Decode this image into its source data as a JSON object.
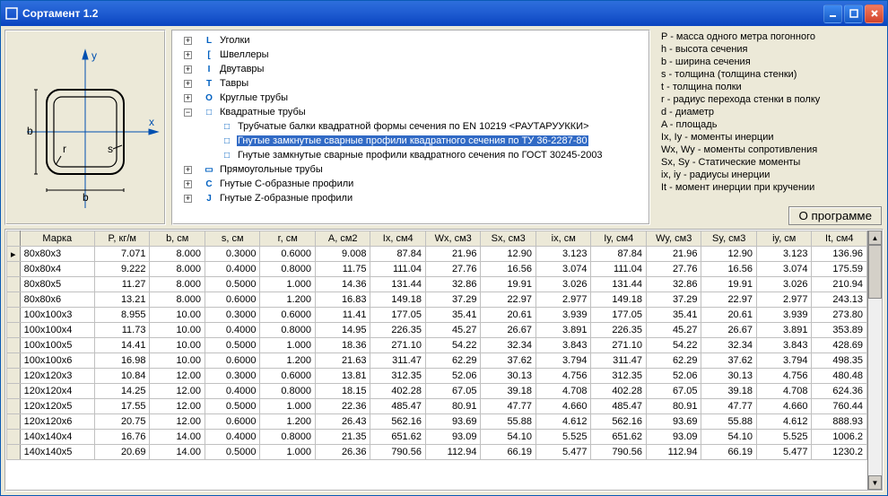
{
  "window": {
    "title": "Сортамент 1.2"
  },
  "tree": [
    {
      "depth": 0,
      "pm": "+",
      "icon": "L",
      "iconColor": "#0060C0",
      "label": "Уголки"
    },
    {
      "depth": 0,
      "pm": "+",
      "icon": "[",
      "iconColor": "#0060C0",
      "label": "Швеллеры"
    },
    {
      "depth": 0,
      "pm": "+",
      "icon": "I",
      "iconColor": "#0060C0",
      "label": "Двутавры"
    },
    {
      "depth": 0,
      "pm": "+",
      "icon": "T",
      "iconColor": "#0060C0",
      "label": "Тавры"
    },
    {
      "depth": 0,
      "pm": "+",
      "icon": "O",
      "iconColor": "#0060C0",
      "label": "Круглые трубы"
    },
    {
      "depth": 0,
      "pm": "−",
      "icon": "□",
      "iconColor": "#0060C0",
      "label": "Квадратные трубы"
    },
    {
      "depth": 1,
      "pm": "",
      "icon": "□",
      "iconColor": "#0060C0",
      "label": "Трубчатые балки квадратной формы сечения по EN 10219 <РАУТАРУУККИ>"
    },
    {
      "depth": 1,
      "pm": "",
      "icon": "□",
      "iconColor": "#0060C0",
      "label": "Гнутые замкнутые сварные профили квадратного сечения по ТУ 36-2287-80",
      "selected": true
    },
    {
      "depth": 1,
      "pm": "",
      "icon": "□",
      "iconColor": "#0060C0",
      "label": "Гнутые замкнутые сварные профили квадратного сечения по ГОСТ 30245-2003"
    },
    {
      "depth": 0,
      "pm": "+",
      "icon": "▭",
      "iconColor": "#0060C0",
      "label": "Прямоугольные трубы"
    },
    {
      "depth": 0,
      "pm": "+",
      "icon": "C",
      "iconColor": "#0060C0",
      "label": "Гнутые C-образные профили"
    },
    {
      "depth": 0,
      "pm": "+",
      "icon": "J",
      "iconColor": "#0060C0",
      "label": "Гнутые Z-образные профили"
    }
  ],
  "legend": [
    "P - масса одного метра погонного",
    "h - высота сечения",
    "b - ширина сечения",
    "s - толщина (толщина стенки)",
    "t - толщина полки",
    "r - радиус перехода стенки в полку",
    "d - диаметр",
    "A - площадь",
    "Ix, Iy - моменты инерции",
    "Wx, Wy - моменты сопротивления",
    "Sx, Sy - Статические моменты",
    "ix, iy - радиусы инерции",
    "It - момент инерции при кручении"
  ],
  "about_btn": "О программе",
  "columns": [
    "Марка",
    "P, кг/м",
    "b, см",
    "s, см",
    "r, см",
    "A, см2",
    "Ix, см4",
    "Wx, см3",
    "Sx, см3",
    "ix, см",
    "Iy, см4",
    "Wy, см3",
    "Sy, см3",
    "iy, см",
    "It, см4"
  ],
  "rows": [
    [
      "80x80x3",
      "7.071",
      "8.000",
      "0.3000",
      "0.6000",
      "9.008",
      "87.84",
      "21.96",
      "12.90",
      "3.123",
      "87.84",
      "21.96",
      "12.90",
      "3.123",
      "136.96"
    ],
    [
      "80x80x4",
      "9.222",
      "8.000",
      "0.4000",
      "0.8000",
      "11.75",
      "111.04",
      "27.76",
      "16.56",
      "3.074",
      "111.04",
      "27.76",
      "16.56",
      "3.074",
      "175.59"
    ],
    [
      "80x80x5",
      "11.27",
      "8.000",
      "0.5000",
      "1.000",
      "14.36",
      "131.44",
      "32.86",
      "19.91",
      "3.026",
      "131.44",
      "32.86",
      "19.91",
      "3.026",
      "210.94"
    ],
    [
      "80x80x6",
      "13.21",
      "8.000",
      "0.6000",
      "1.200",
      "16.83",
      "149.18",
      "37.29",
      "22.97",
      "2.977",
      "149.18",
      "37.29",
      "22.97",
      "2.977",
      "243.13"
    ],
    [
      "100x100x3",
      "8.955",
      "10.00",
      "0.3000",
      "0.6000",
      "11.41",
      "177.05",
      "35.41",
      "20.61",
      "3.939",
      "177.05",
      "35.41",
      "20.61",
      "3.939",
      "273.80"
    ],
    [
      "100x100x4",
      "11.73",
      "10.00",
      "0.4000",
      "0.8000",
      "14.95",
      "226.35",
      "45.27",
      "26.67",
      "3.891",
      "226.35",
      "45.27",
      "26.67",
      "3.891",
      "353.89"
    ],
    [
      "100x100x5",
      "14.41",
      "10.00",
      "0.5000",
      "1.000",
      "18.36",
      "271.10",
      "54.22",
      "32.34",
      "3.843",
      "271.10",
      "54.22",
      "32.34",
      "3.843",
      "428.69"
    ],
    [
      "100x100x6",
      "16.98",
      "10.00",
      "0.6000",
      "1.200",
      "21.63",
      "311.47",
      "62.29",
      "37.62",
      "3.794",
      "311.47",
      "62.29",
      "37.62",
      "3.794",
      "498.35"
    ],
    [
      "120x120x3",
      "10.84",
      "12.00",
      "0.3000",
      "0.6000",
      "13.81",
      "312.35",
      "52.06",
      "30.13",
      "4.756",
      "312.35",
      "52.06",
      "30.13",
      "4.756",
      "480.48"
    ],
    [
      "120x120x4",
      "14.25",
      "12.00",
      "0.4000",
      "0.8000",
      "18.15",
      "402.28",
      "67.05",
      "39.18",
      "4.708",
      "402.28",
      "67.05",
      "39.18",
      "4.708",
      "624.36"
    ],
    [
      "120x120x5",
      "17.55",
      "12.00",
      "0.5000",
      "1.000",
      "22.36",
      "485.47",
      "80.91",
      "47.77",
      "4.660",
      "485.47",
      "80.91",
      "47.77",
      "4.660",
      "760.44"
    ],
    [
      "120x120x6",
      "20.75",
      "12.00",
      "0.6000",
      "1.200",
      "26.43",
      "562.16",
      "93.69",
      "55.88",
      "4.612",
      "562.16",
      "93.69",
      "55.88",
      "4.612",
      "888.93"
    ],
    [
      "140x140x4",
      "16.76",
      "14.00",
      "0.4000",
      "0.8000",
      "21.35",
      "651.62",
      "93.09",
      "54.10",
      "5.525",
      "651.62",
      "93.09",
      "54.10",
      "5.525",
      "1006.2"
    ],
    [
      "140x140x5",
      "20.69",
      "14.00",
      "0.5000",
      "1.000",
      "26.36",
      "790.56",
      "112.94",
      "66.19",
      "5.477",
      "790.56",
      "112.94",
      "66.19",
      "5.477",
      "1230.2"
    ]
  ],
  "diagram_labels": {
    "x": "x",
    "y": "y",
    "b_h": "b",
    "b_w": "b",
    "r": "r",
    "s": "s"
  }
}
